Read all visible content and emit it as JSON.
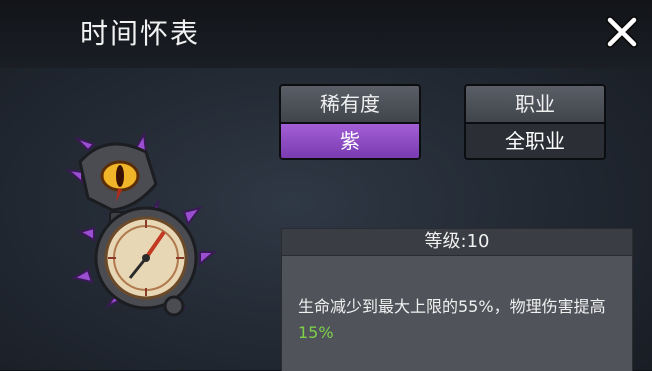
{
  "title": "时间怀表",
  "icons": {
    "close": "close-icon",
    "item": "pocket-watch-eye-icon"
  },
  "rarity": {
    "label": "稀有度",
    "value": "紫",
    "color": "#8e4cc6"
  },
  "job": {
    "label": "职业",
    "value": "全职业"
  },
  "level": {
    "text": "等级:10"
  },
  "description": {
    "before": "生命减少到最大上限的55%，物理伤害提高",
    "highlight": "15%",
    "highlight_color": "#7cd04a"
  }
}
